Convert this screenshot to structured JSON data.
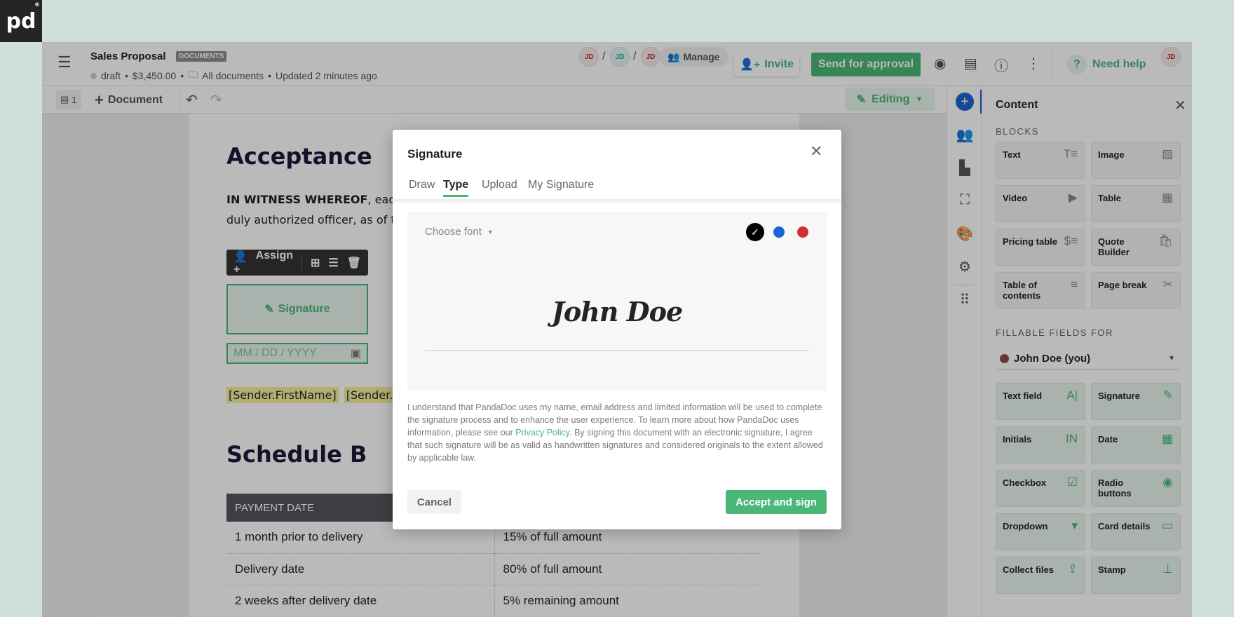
{
  "logo": {
    "text": "pd",
    "mark": "®"
  },
  "header": {
    "title": "Sales Proposal",
    "badge": "DOCUMENTS",
    "status": "draft",
    "amount": "$3,450.00",
    "folder": "All documents",
    "updated": "Updated 2 minutes ago",
    "avatars": [
      "JD",
      "JD",
      "JD"
    ],
    "manage": "Manage",
    "invite": "Invite",
    "send": "Send for approval",
    "help": "Need help",
    "user_avatar": "JD"
  },
  "toolbar": {
    "pages": "1",
    "document": "Document",
    "mode": "Editing"
  },
  "doc": {
    "heading": "Acceptance",
    "para_bold": "IN WITNESS WHEREOF",
    "para_line1": ", each",
    "para_line2": "duly authorized officer, as of th",
    "assign": "Assign",
    "signature_field": "Signature",
    "date_placeholder": "MM / DD / YYYY",
    "tags": [
      "[Sender.FirstName]",
      "[Sender.La"
    ],
    "heading2": "Schedule B",
    "table": {
      "header": [
        "PAYMENT DATE",
        ""
      ],
      "rows": [
        [
          "1 month prior to delivery",
          "15% of full amount"
        ],
        [
          "Delivery date",
          "80% of full amount"
        ],
        [
          "2 weeks after delivery date",
          "5% remaining amount"
        ]
      ]
    }
  },
  "panel": {
    "title": "Content",
    "blocks_label": "BLOCKS",
    "blocks": [
      {
        "label": "Text",
        "icon": "T≡"
      },
      {
        "label": "Image",
        "icon": "▨"
      },
      {
        "label": "Video",
        "icon": "▶"
      },
      {
        "label": "Table",
        "icon": "▦"
      },
      {
        "label": "Pricing table",
        "icon": "$≡"
      },
      {
        "label": "Quote Builder",
        "icon": "🛍"
      },
      {
        "label": "Table of contents",
        "icon": "≡"
      },
      {
        "label": "Page break",
        "icon": "✂"
      }
    ],
    "fillable_label": "FILLABLE FIELDS FOR",
    "recipient": "John Doe (you)",
    "recipient_color": "#8a4a4a",
    "fields": [
      {
        "label": "Text field",
        "icon": "A|"
      },
      {
        "label": "Signature",
        "icon": "✎"
      },
      {
        "label": "Initials",
        "icon": "IN"
      },
      {
        "label": "Date",
        "icon": "▦"
      },
      {
        "label": "Checkbox",
        "icon": "☑"
      },
      {
        "label": "Radio buttons",
        "icon": "◉"
      },
      {
        "label": "Dropdown",
        "icon": "▾"
      },
      {
        "label": "Card details",
        "icon": "▭"
      },
      {
        "label": "Collect files",
        "icon": "⇪"
      },
      {
        "label": "Stamp",
        "icon": "⊥"
      }
    ]
  },
  "dialog": {
    "title": "Signature",
    "tabs": [
      "Draw",
      "Type",
      "Upload",
      "My Signature"
    ],
    "active_tab": "Type",
    "font_select": "Choose font",
    "colors": [
      "#000000",
      "#1b64d2",
      "#d32f2f"
    ],
    "selected_color": "#000000",
    "signature_text": "John Doe",
    "disclaimer_1": "I understand that PandaDoc uses my name, email address and limited information will be used to complete the signature process and to enhance the user experience. To learn more about how PandaDoc uses information, please see our ",
    "privacy_link": "Privacy Policy",
    "disclaimer_2": ". By signing this document with an electronic signature, I agree that such signature will be as valid as handwritten signatures and considered originals to the extent allowed by applicable law.",
    "cancel": "Cancel",
    "accept": "Accept and sign"
  },
  "colors": {
    "accent_green": "#4ab776",
    "brand_blue": "#1b64d2"
  }
}
